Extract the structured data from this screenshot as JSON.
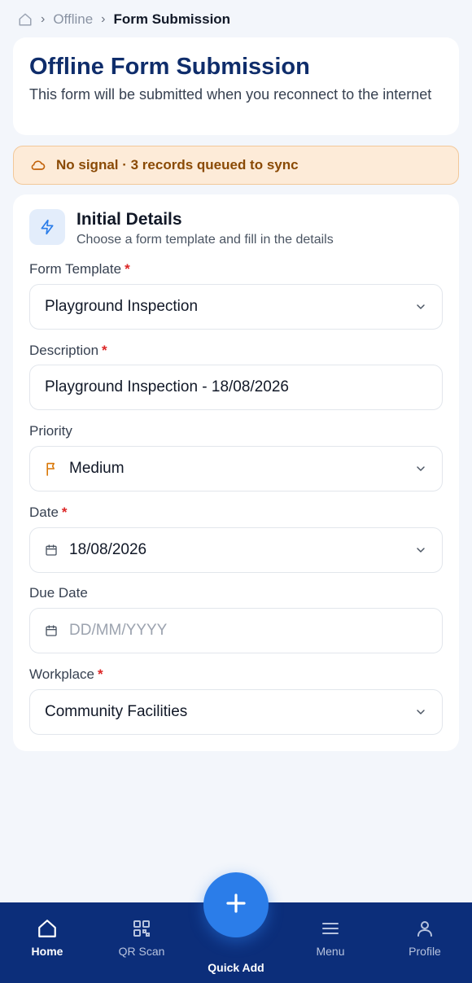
{
  "breadcrumb": {
    "items": [
      "Offline",
      "Form Submission"
    ]
  },
  "header": {
    "title": "Offline Form Submission",
    "subtitle": "This form will be submitted when you reconnect to the internet"
  },
  "alert": {
    "text": "No signal · 3 records queued to sync",
    "icon": "cloud-off-icon"
  },
  "section": {
    "title": "Initial Details",
    "subtitle": "Choose a form template and fill in the details",
    "icon": "lightning-icon"
  },
  "form": {
    "template": {
      "label": "Form Template",
      "required": "*",
      "value": "Playground Inspection"
    },
    "description": {
      "label": "Description",
      "required": "*",
      "value": "Playground Inspection - 18/08/2026"
    },
    "priority": {
      "label": "Priority",
      "value": "Medium"
    },
    "date": {
      "label": "Date",
      "required": "*",
      "value": "18/08/2026"
    },
    "due_date": {
      "label": "Due Date",
      "placeholder": "DD/MM/YYYY"
    },
    "workplace": {
      "label": "Workplace",
      "required": "*",
      "value": "Community Facilities"
    }
  },
  "nav": {
    "home": "Home",
    "qr": "QR Scan",
    "quick_add": "Quick Add",
    "menu": "Menu",
    "profile": "Profile"
  },
  "colors": {
    "primary": "#0c2e7a",
    "accent": "#2b7de9",
    "warning_bg": "#fdebd8",
    "warning_text": "#8a4a05",
    "required": "#dc2626",
    "priority_flag": "#d97706"
  }
}
